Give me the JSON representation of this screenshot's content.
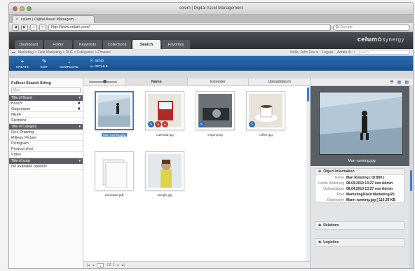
{
  "window": {
    "title": "celum | Digital Asset Management"
  },
  "browser": {
    "tab_title": "celum | Digital Asset Managem...",
    "url": "http://www.celum.com/",
    "search_placeholder": "Google"
  },
  "app": {
    "tabs": [
      {
        "label": "Dashboard"
      },
      {
        "label": "Folder"
      },
      {
        "label": "Keywords"
      },
      {
        "label": "Collections"
      },
      {
        "label": "Search"
      },
      {
        "label": "Favorites"
      }
    ],
    "active_tab": "Search",
    "logo": {
      "main": "celum",
      "sub": "synergy"
    }
  },
  "breadcrumb": {
    "path": "Marketing > Field Marketing > DLG > Categories > Phrases"
  },
  "user": {
    "greeting": "Hello, John Doe ▾",
    "logout": "Logout",
    "admin": "Admin ⚙"
  },
  "header_search": {
    "placeholder": "Search"
  },
  "actions": [
    {
      "label": "CREATE",
      "icon": "plus-icon"
    },
    {
      "label": "EDIT",
      "icon": "pencil-icon"
    },
    {
      "label": "DOWNLOAD",
      "icon": "download-icon"
    }
  ],
  "actions_stack": [
    {
      "label": "SEND",
      "icon": "send-icon"
    },
    {
      "label": "DETAILS",
      "icon": "folder-icon"
    }
  ],
  "left": {
    "heading": "Fulltext Search String",
    "search_value": "Mus",
    "sections": [
      {
        "title": "Title of Brand",
        "items": [
          "Bosch",
          "Gagenauer",
          "NEFF",
          "Siemens"
        ]
      },
      {
        "title": "Title of Category",
        "items": [
          "Line Drawing",
          "Milieau Picture",
          "Pictogram",
          "Product shot",
          "Video"
        ]
      },
      {
        "title": "Title of scop",
        "items": [
          "No available options!"
        ]
      }
    ]
  },
  "sort": {
    "columns": [
      "Name",
      "Extender",
      "Uploaddatum"
    ],
    "active": "Name"
  },
  "assets": [
    {
      "name": "Man running.jpg",
      "selected": true
    },
    {
      "name": "Calendar.jpg",
      "selected": false
    },
    {
      "name": "import.png",
      "selected": false
    },
    {
      "name": "coffee.jpg",
      "selected": false
    },
    {
      "name": "Schedule.pdf",
      "selected": false
    },
    {
      "name": "Jacqlin.jpg",
      "selected": false
    }
  ],
  "pager": {
    "page": "1",
    "of_label": "OF 1"
  },
  "preview": {
    "caption": "Man running.jpg"
  },
  "object_info": {
    "title": "Object Information",
    "rows": [
      {
        "k": "Name",
        "v": "Man Running ( ID:800 )"
      },
      {
        "k": "Letzte Änderung",
        "v": "08.04.2010 13:27 von Admin"
      },
      {
        "k": "Uploaddatum",
        "v": "08.04.2010 13:27 von Admin"
      },
      {
        "k": "Pfad",
        "v": "Marketing/Field Marketing/20"
      },
      {
        "k": "Dateiname",
        "v": "Mann running.jpg ( 110,39 KB"
      }
    ]
  },
  "panels": {
    "relations": "Relations",
    "logistics": "Logistics"
  }
}
